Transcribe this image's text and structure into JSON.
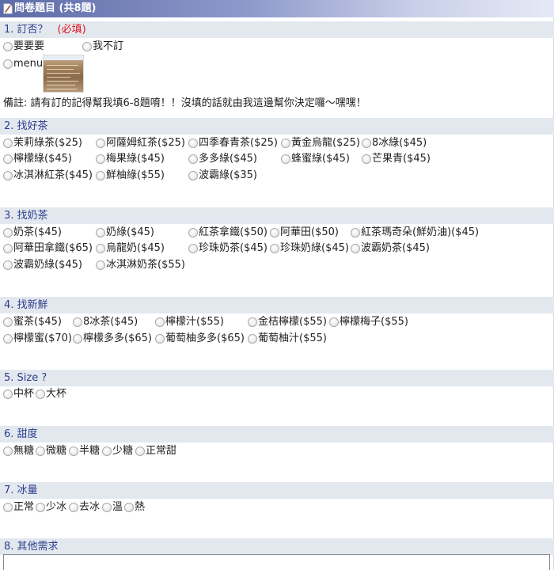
{
  "header": {
    "title": "問卷題目 (共8題)",
    "icon": "document-icon"
  },
  "q1": {
    "title": "1. 訂否？",
    "required": "(必填)",
    "options": [
      "要要要",
      "我不訂",
      "menu"
    ],
    "note": "備註: 請有訂的記得幫我填6-8題唷！！沒填的話就由我這邊幫你決定囉～嘿嘿！"
  },
  "q2": {
    "title": "2. 找好茶",
    "options": [
      "茉莉綠茶($25)",
      "阿薩姆紅茶($25)",
      "四季春青茶($25)",
      "黃金烏龍($25)",
      "8冰綠($45)",
      "檸檬綠($45)",
      "梅果綠($45)",
      "多多綠($45)",
      "蜂蜜綠($45)",
      "芒果青($45)",
      "冰淇淋紅茶($45)",
      "鮮柚綠($55)",
      "波霸綠($35)"
    ]
  },
  "q3": {
    "title": "3. 找奶茶",
    "options": [
      "奶茶($45)",
      "奶綠($45)",
      "紅茶拿鐵($50)",
      "阿華田($50)",
      "紅茶瑪奇朵(鮮奶油)($45)",
      "阿華田拿鐵($65)",
      "烏龍奶($45)",
      "珍珠奶茶($45)",
      "珍珠奶綠($45)",
      "波霸奶茶($45)",
      "波霸奶綠($45)",
      "冰淇淋奶茶($55)"
    ]
  },
  "q4": {
    "title": "4. 找新鮮",
    "options": [
      "蜜茶($45)",
      "8冰茶($45)",
      "檸檬汁($55)",
      "金桔檸檬($55)",
      "檸檬梅子($55)",
      "檸檬蜜($70)",
      "檸檬多多($65)",
      "葡萄柚多多($65)",
      "葡萄柚汁($55)"
    ]
  },
  "q5": {
    "title": "5. Size ?",
    "options": [
      "中杯",
      "大杯"
    ]
  },
  "q6": {
    "title": "6. 甜度",
    "options": [
      "無糖",
      "微糖",
      "半糖",
      "少糖",
      "正常甜"
    ]
  },
  "q7": {
    "title": "7. 冰量",
    "options": [
      "正常",
      "少冰",
      "去冰",
      "溫",
      "熱"
    ]
  },
  "q8": {
    "title": "8. 其他需求",
    "input_value": ""
  }
}
